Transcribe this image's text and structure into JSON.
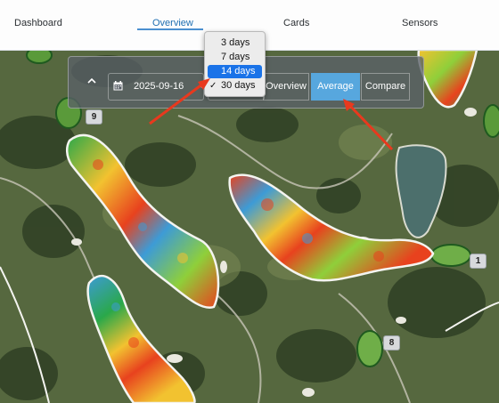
{
  "nav": {
    "items": [
      "Dashboard",
      "Overview",
      "Cards",
      "Sensors"
    ],
    "active": "Overview"
  },
  "toolbar": {
    "date": "2025-09-16",
    "range_selected": "30 days",
    "views": [
      "Overview",
      "Average",
      "Compare"
    ],
    "selected_view": "Average"
  },
  "range_dropdown": {
    "options": [
      "3 days",
      "7 days",
      "14 days",
      "30 days"
    ],
    "highlighted": "14 days",
    "checked": "30 days"
  },
  "hole_badges": [
    "9",
    "1",
    "8"
  ],
  "colors": {
    "accent": "#57a7de",
    "highlight": "#1a73e8",
    "annotation_arrow": "#e8391e"
  }
}
